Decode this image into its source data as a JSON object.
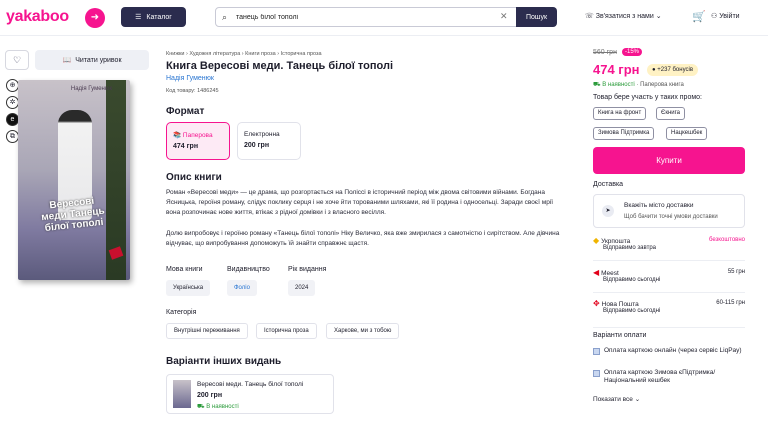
{
  "header": {
    "logo": "yakaboo",
    "catalog_label": "Каталог",
    "search_value": "танець білої тополі",
    "search_button": "Пошук",
    "contact_label": "Зв'язатися з нами",
    "login_label": "Увійти"
  },
  "left": {
    "read_excerpt": "Читати уривок",
    "cover": {
      "author": "Надія Гуменюк",
      "title": "Вересові меди Танець білої тополі"
    }
  },
  "product": {
    "breadcrumbs": [
      "Книжки",
      "Художня література",
      "Книги проза",
      "Історична проза"
    ],
    "title": "Книга Вересові меди. Танець білої тополі",
    "author": "Надія Гуменюк",
    "code": "Код товару: 1486245",
    "format_heading": "Формат",
    "formats": [
      {
        "label": "Паперова",
        "price": "474 грн"
      },
      {
        "label": "Електронна",
        "price": "200 грн"
      }
    ],
    "description_heading": "Опис книги",
    "description_p1": "Роман «Вересові меди» — це драма, що розгортається на Поліссі в історичний період між двома світовими війнами. Богдана Ясницька, героїня роману, слідує поклику серця і не хоче йти торованими шляхами, які її родина і односельці. Заради своєї мрії вона розпочинає нове життя, втікає з рідної домівки і з власного весілля.",
    "description_p2": "Долю випробовує і героїню роману «Танець білої тополі» Ніку Величко, яка вже змирилася з самотністю і сирітством. Але дівчина відчуває, що випробування допоможуть їй знайти справжнє щастя.",
    "meta": [
      {
        "label": "Мова книги",
        "value": "Українська"
      },
      {
        "label": "Видавництво",
        "value": "Фоліо"
      },
      {
        "label": "Рік видання",
        "value": "2024"
      }
    ],
    "category_heading": "Категорія",
    "categories": [
      "Внутрішні переживання",
      "Історична проза",
      "Харкове, ми з тобою"
    ],
    "variants_heading": "Варіанти інших видань",
    "variant": {
      "title": "Вересові меди. Танець білої тополі",
      "price": "200 грн",
      "availability": "В наявності"
    }
  },
  "buy": {
    "old_price": "560 грн",
    "discount": "-15%",
    "price": "474 грн",
    "bonus": "+237 бонусів",
    "stock": "В наявності",
    "stock_type": "· Паперова книга",
    "campaign_title": "Товар бере участь у таких промо:",
    "tags": [
      "Книга на фронт",
      "Єкнига",
      "Зимова Підтримка",
      "Нацкешбек"
    ],
    "buy_button": "Купити",
    "delivery_heading": "Доставка",
    "delivery_box_title": "Вкажіть місто доставки",
    "delivery_box_sub": "Щоб бачити точні умови доставки",
    "carriers": [
      {
        "name": "Укрпошта",
        "when": "Відправимо завтра",
        "price": "безкоштовно"
      },
      {
        "name": "Meest",
        "when": "Відправимо сьогодні",
        "price": "55 грн"
      },
      {
        "name": "Нова Пошта",
        "when": "Відправимо сьогодні",
        "price": "60-115 грн"
      }
    ],
    "payment_heading": "Варіанти оплати",
    "payments": [
      "Оплата карткою онлайн (через сервіс LiqPay)",
      "Оплата карткою Зимова єПідтримка/ Національний кешбек"
    ],
    "show_all": "Показати все"
  },
  "colors": {
    "brand": "#f6148f",
    "dark": "#2b2c4e",
    "green": "#2a9b3a"
  }
}
